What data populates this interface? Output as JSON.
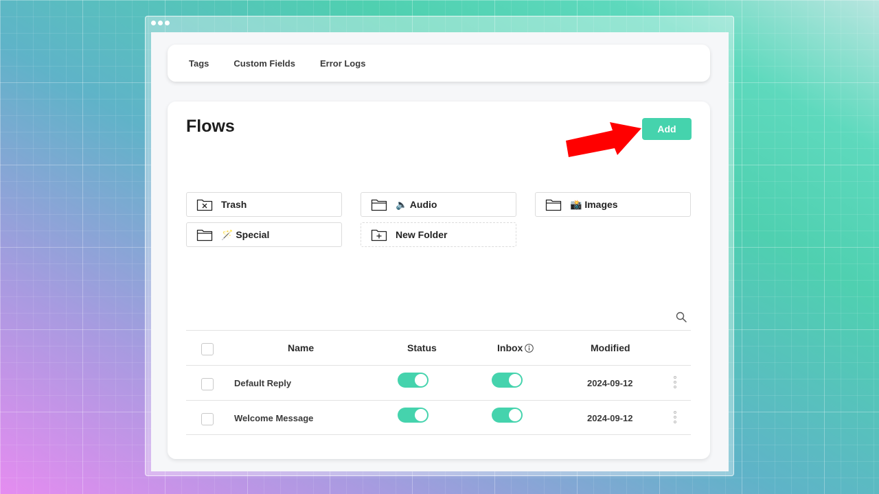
{
  "nav": {
    "tabs": [
      {
        "label": "Tags"
      },
      {
        "label": "Custom Fields"
      },
      {
        "label": "Error Logs"
      }
    ]
  },
  "page": {
    "title": "Flows",
    "add_label": "Add"
  },
  "folders": [
    {
      "label": "Trash",
      "icon": "folder-x-icon"
    },
    {
      "label": "🔈 Audio",
      "icon": "folder-icon"
    },
    {
      "label": "📸 Images",
      "icon": "folder-icon"
    },
    {
      "label": "🪄 Special",
      "icon": "folder-icon"
    },
    {
      "label": "New Folder",
      "icon": "folder-plus-icon"
    }
  ],
  "table": {
    "headers": {
      "name": "Name",
      "status": "Status",
      "inbox": "Inbox",
      "modified": "Modified"
    },
    "rows": [
      {
        "name": "Default Reply",
        "status_on": true,
        "inbox_on": true,
        "modified": "2024-09-12"
      },
      {
        "name": "Welcome Message",
        "status_on": true,
        "inbox_on": true,
        "modified": "2024-09-12"
      }
    ]
  },
  "colors": {
    "accent": "#45d3ad",
    "annotation_arrow": "#ff0000"
  }
}
